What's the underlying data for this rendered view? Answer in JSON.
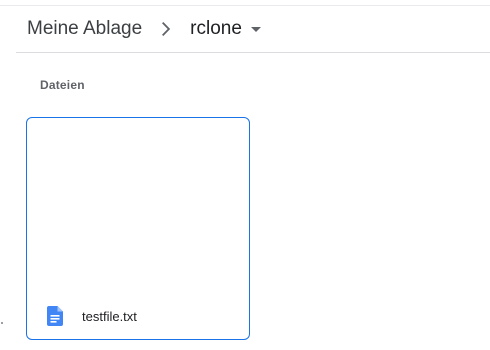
{
  "breadcrumb": {
    "root_label": "Meine Ablage",
    "current_label": "rclone",
    "separator_icon": "chevron-right-icon",
    "dropdown_icon": "arrow-drop-down-icon"
  },
  "section": {
    "title": "Dateien"
  },
  "files": [
    {
      "name": "testfile.txt",
      "icon": "google-docs-icon",
      "icon_color": "#4285f4"
    }
  ],
  "colors": {
    "selection_border": "#1a73e8",
    "divider": "#dadce0"
  }
}
